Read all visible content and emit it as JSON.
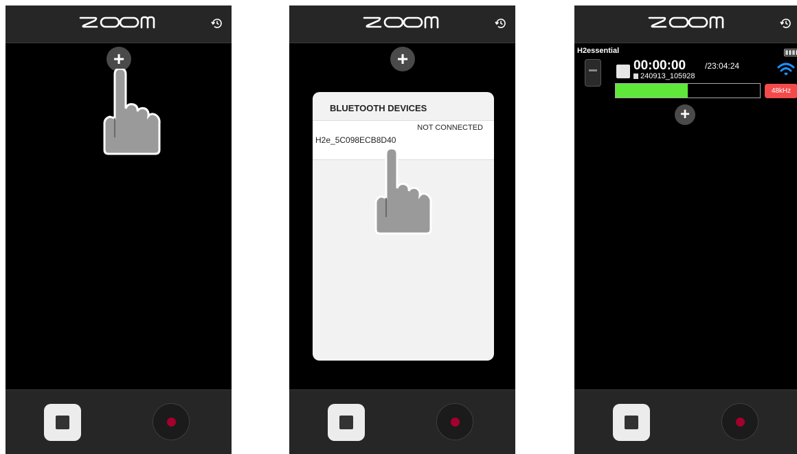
{
  "app": {
    "logo_text": "ZOOM"
  },
  "icons": {
    "history": "history-icon",
    "add": "plus-icon",
    "hand": "tap-hand-icon",
    "wifi": "wifi-icon",
    "battery": "battery-icon"
  },
  "buttons": {
    "add": "+"
  },
  "colors": {
    "background": "#000000",
    "bar": "#262626",
    "record_dot": "#a4002e",
    "meter_green": "#5ee83a",
    "badge_red": "#f14b4b",
    "wifi_blue": "#1e90ff"
  },
  "bluetooth": {
    "title": "BLUETOOTH DEVICES",
    "devices": [
      {
        "name": "H2e_5C098ECB8D40",
        "status": "NOT CONNECTED"
      }
    ]
  },
  "device": {
    "name": "H2essential",
    "elapsed": "00:00:00",
    "remaining": "/23:04:24",
    "file": "240913_105928",
    "level": 0.5,
    "sample_rate": "48kHz",
    "battery_bars": 4
  }
}
